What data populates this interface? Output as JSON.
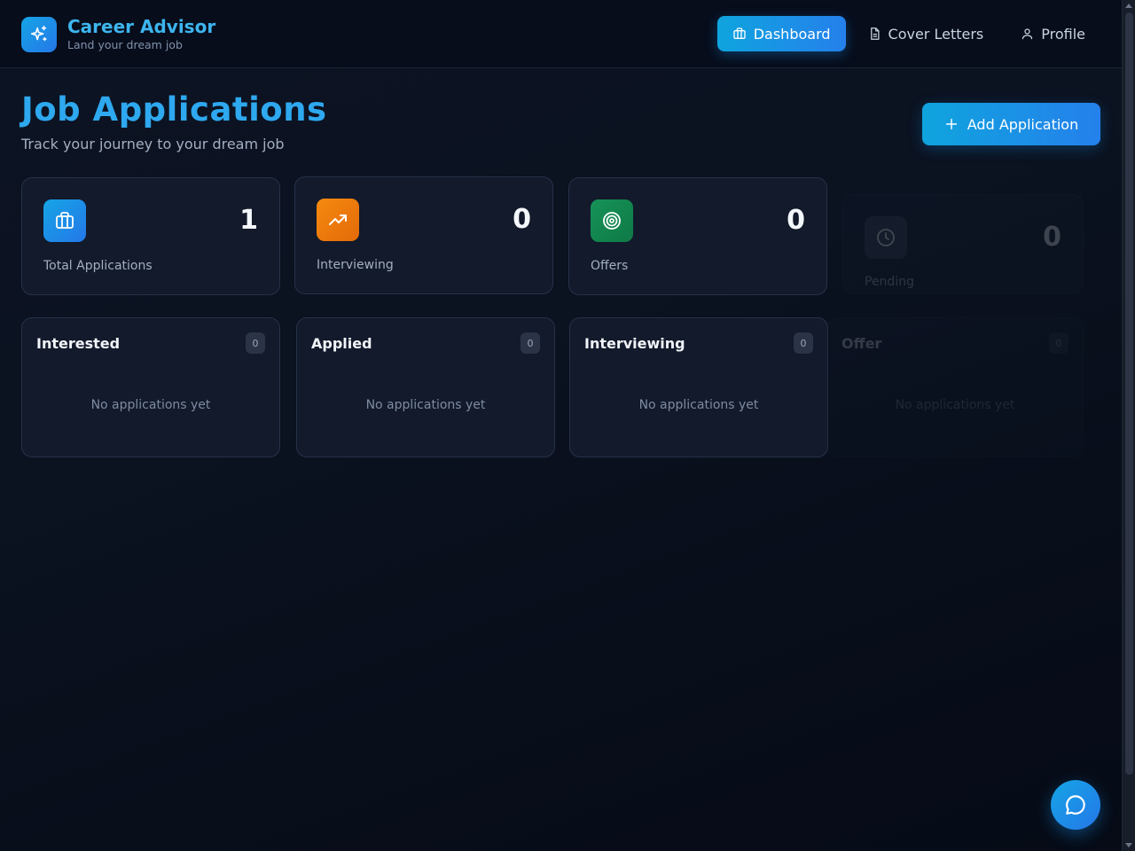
{
  "brand": {
    "title": "Career Advisor",
    "subtitle": "Land your dream job",
    "logo_icon": "sparkles-icon"
  },
  "nav": {
    "items": [
      {
        "label": "Dashboard",
        "icon": "briefcase-icon",
        "active": true
      },
      {
        "label": "Cover Letters",
        "icon": "document-icon",
        "active": false
      },
      {
        "label": "Profile",
        "icon": "user-icon",
        "active": false
      }
    ]
  },
  "header": {
    "title": "Job Applications",
    "subtitle": "Track your journey to your dream job",
    "add_button_label": "Add Application",
    "add_button_icon": "plus-icon"
  },
  "stats": [
    {
      "label": "Total Applications",
      "value": "1",
      "icon": "briefcase-icon",
      "color": "#1e90ee"
    },
    {
      "label": "Interviewing",
      "value": "0",
      "icon": "trending-up-icon",
      "color": "#ef7a0c"
    },
    {
      "label": "Offers",
      "value": "0",
      "icon": "target-icon",
      "color": "#13844d"
    },
    {
      "label": "Pending",
      "value": "0",
      "icon": "clock-icon",
      "color": "#3b4556"
    }
  ],
  "columns": [
    {
      "title": "Interested",
      "count": "0",
      "empty_text": "No applications yet"
    },
    {
      "title": "Applied",
      "count": "0",
      "empty_text": "No applications yet"
    },
    {
      "title": "Interviewing",
      "count": "0",
      "empty_text": "No applications yet"
    },
    {
      "title": "Offer",
      "count": "0",
      "empty_text": "No applications yet"
    }
  ],
  "chat": {
    "icon": "chat-bubble-icon"
  },
  "colors": {
    "accent": "#1e90ee",
    "background": "#0b1220",
    "card": "#121a2b"
  }
}
